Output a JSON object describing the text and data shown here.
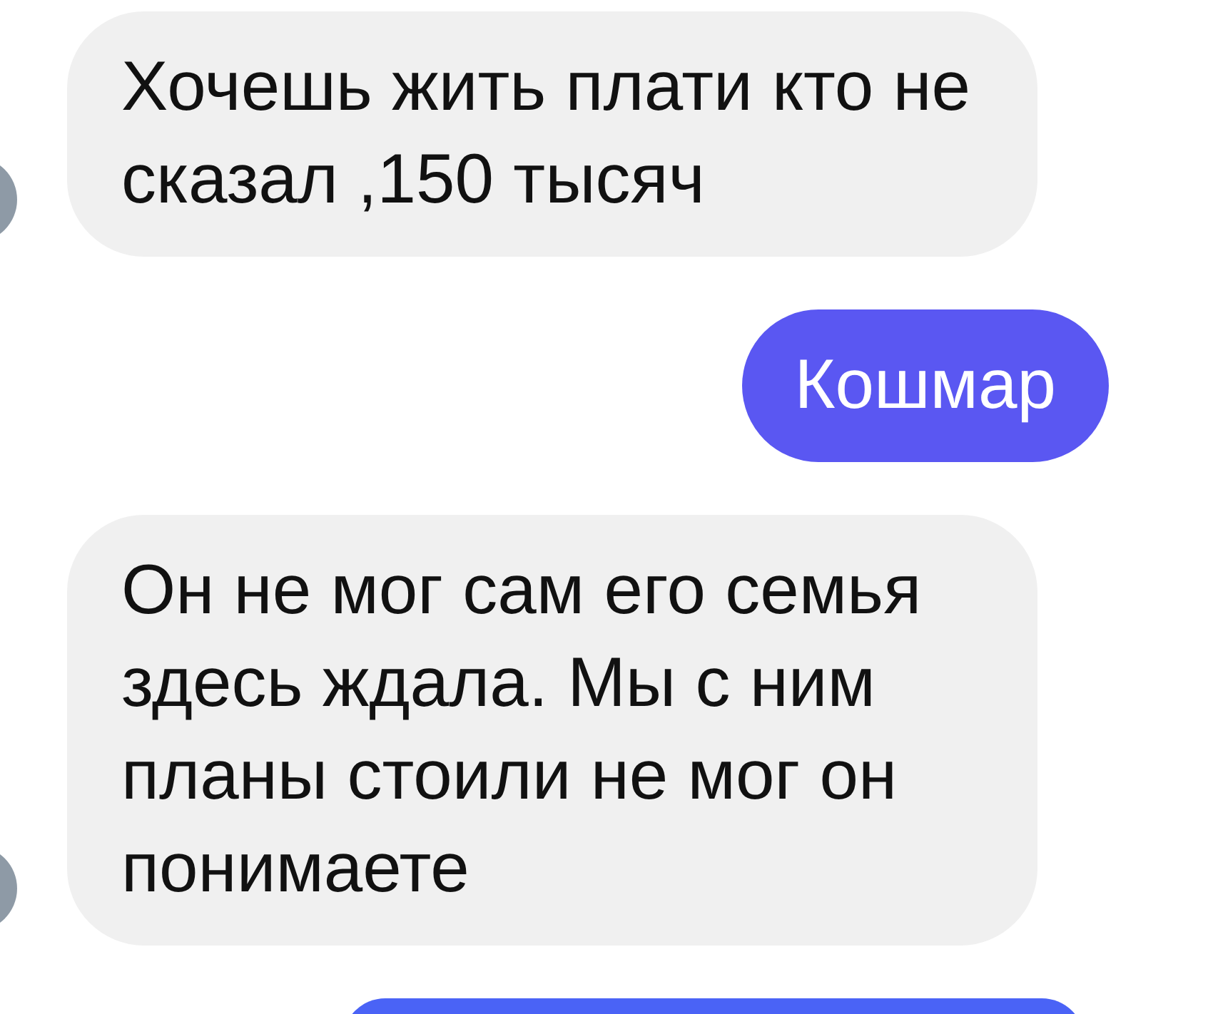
{
  "messages": [
    {
      "kind": "incoming",
      "text": "Хочешь жить плати кто не сказал ,150 тысяч"
    },
    {
      "kind": "outgoing",
      "text": "Кошмар"
    },
    {
      "kind": "incoming",
      "text": "Он не мог сам его семья здесь ждала. Мы с ним планы стоили не мог он понимаете"
    },
    {
      "kind": "outgoing"
    }
  ]
}
